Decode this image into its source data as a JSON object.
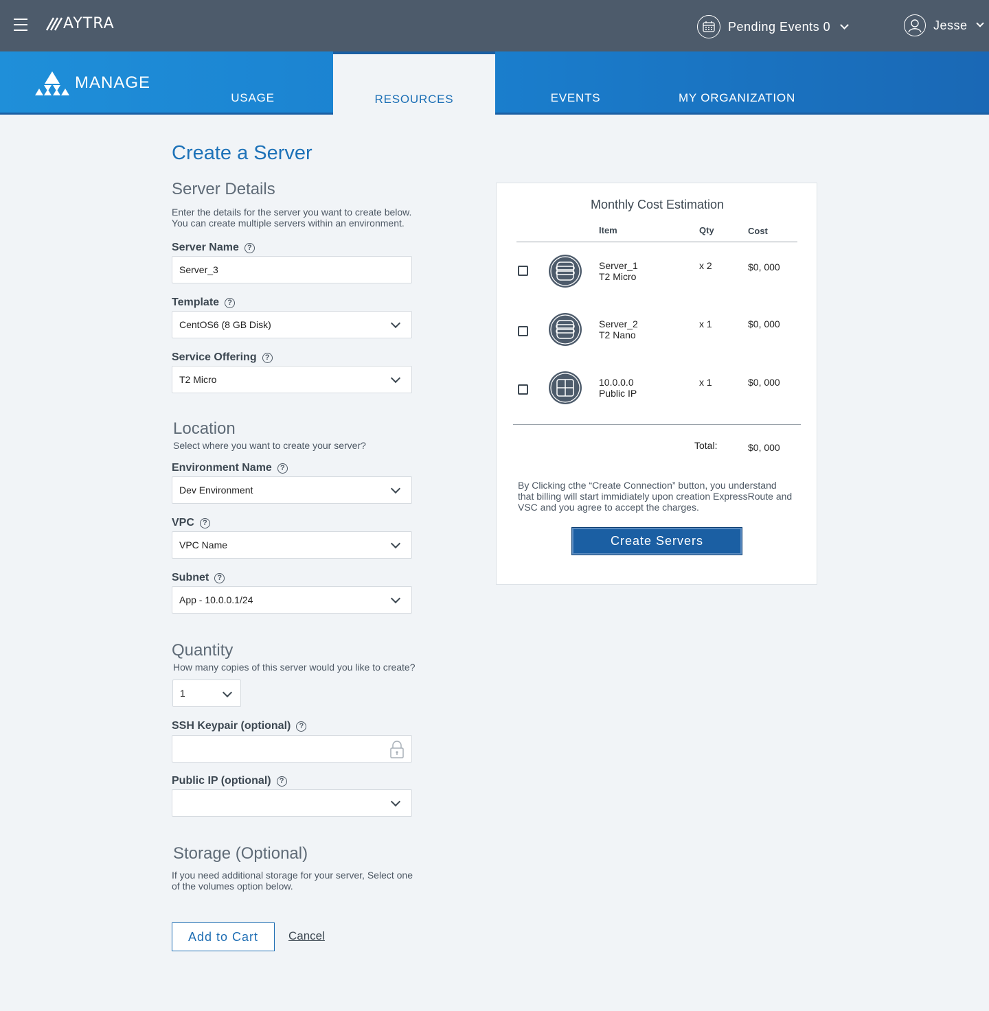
{
  "header": {
    "brand": "AYTRA",
    "pending_label": "Pending Events 0",
    "user_name": "Jesse"
  },
  "nav": {
    "section": "MANAGE",
    "tabs": [
      {
        "label": "USAGE",
        "active": false
      },
      {
        "label": "RESOURCES",
        "active": true
      },
      {
        "label": "EVENTS",
        "active": false
      },
      {
        "label": "MY ORGANIZATION",
        "active": false
      }
    ]
  },
  "page": {
    "title": "Create a Server"
  },
  "server_details": {
    "title": "Server Details",
    "desc_1": "Enter the details for the server you want to create below.",
    "desc_2": "You can create multiple servers within an environment.",
    "server_name_label": "Server Name",
    "server_name_value": "Server_3",
    "template_label": "Template",
    "template_value": "CentOS6 (8 GB Disk)",
    "service_offering_label": "Service Offering",
    "service_offering_value": "T2 Micro"
  },
  "location": {
    "title": "Location",
    "desc": "Select where you want to create your server?",
    "environment_label": "Environment Name",
    "environment_value": "Dev Environment",
    "vpc_label": "VPC",
    "vpc_value": "VPC Name",
    "subnet_label": "Subnet",
    "subnet_value": "App - 10.0.0.1/24"
  },
  "quantity": {
    "title": "Quantity",
    "desc": "How many copies of this server would you like to create?",
    "value": "1",
    "ssh_label": "SSH Keypair (optional)",
    "ssh_value": "",
    "public_ip_label": "Public IP (optional)",
    "public_ip_value": ""
  },
  "storage": {
    "title": "Storage (Optional)",
    "desc_1": "If you need additional storage for your server, Select one",
    "desc_2": "of the volumes option below."
  },
  "actions": {
    "add_to_cart": "Add to Cart",
    "cancel": "Cancel"
  },
  "cost": {
    "title": "Monthly Cost Estimation",
    "col_item": "Item",
    "col_qty": "Qty",
    "col_cost": "Cost",
    "rows": [
      {
        "name": "Server_1",
        "sub": "T2 Micro",
        "qty": "x 2",
        "cost": "$0, 000",
        "icon": "server-icon"
      },
      {
        "name": "Server_2",
        "sub": "T2 Nano",
        "qty": "x 1",
        "cost": "$0, 000",
        "icon": "server-icon"
      },
      {
        "name": "10.0.0.0",
        "sub": "Public IP",
        "qty": "x 1",
        "cost": "$0, 000",
        "icon": "network-grid-icon"
      }
    ],
    "total_label": "Total:",
    "total_value": "$0, 000",
    "disclaimer": "By Clicking cthe “Create Connection” button, you understand that billing will start immidiately upon creation ExpressRoute and VSC and you agree to accept the charges.",
    "button": "Create Servers"
  },
  "colors": {
    "topbar": "#4d5b6b",
    "nav_blue": "#1a80cf",
    "accent": "#1b5fa3",
    "page_bg": "#f1f4f7"
  }
}
